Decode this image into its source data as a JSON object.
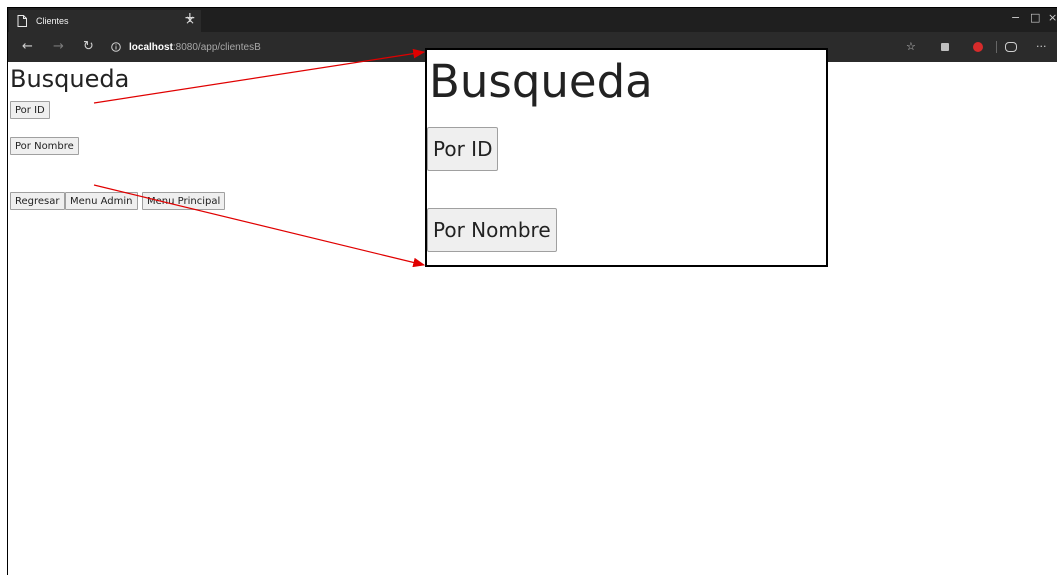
{
  "browser": {
    "tab_title": "Clientes",
    "tab_close": "×",
    "new_tab": "+",
    "nav": {
      "back": "←",
      "forward": "→",
      "refresh": "↻"
    },
    "url_host": "localhost",
    "url_rest": ":8080/app/clientesB",
    "window": {
      "minimize": "−",
      "restore": "□",
      "close": "×"
    },
    "toolbar": {
      "favorite": "☆",
      "more": "···"
    }
  },
  "page": {
    "title": "Busqueda",
    "btn_por_id": "Por ID",
    "btn_por_nombre": "Por Nombre",
    "btn_regresar": "Regresar",
    "btn_menu_admin": "Menu Admin",
    "btn_menu_principal": "Menu Principal"
  },
  "zoom": {
    "title": "Busqueda",
    "btn_por_id": "Por ID",
    "btn_por_nombre": "Por Nombre"
  },
  "colors": {
    "annotation_arrow": "#e00000",
    "browser_chrome": "#2b2b2b"
  }
}
